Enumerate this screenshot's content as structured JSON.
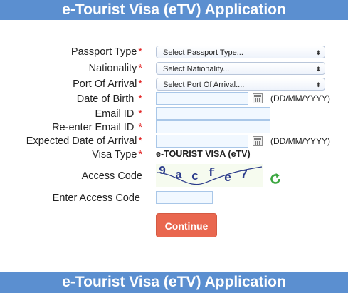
{
  "header": {
    "title": "e-Tourist Visa (eTV) Application"
  },
  "footer": {
    "title": "e-Tourist Visa (eTV) Application"
  },
  "form": {
    "passport_type": {
      "label": "Passport Type",
      "selected": "Select Passport Type..."
    },
    "nationality": {
      "label": "Nationality",
      "selected": "Select Nationality..."
    },
    "port_of_arrival": {
      "label": "Port Of Arrival",
      "selected": "Select Port Of Arrival...."
    },
    "date_of_birth": {
      "label": "Date of Birth",
      "value": "",
      "format_hint": "(DD/MM/YYYY)"
    },
    "email": {
      "label": "Email ID",
      "value": ""
    },
    "reenter_email": {
      "label": "Re-enter Email ID",
      "value": ""
    },
    "expected_arrival": {
      "label": "Expected Date of Arrival",
      "value": "",
      "format_hint": "(DD/MM/YYYY)"
    },
    "visa_type": {
      "label": "Visa Type",
      "value": "e-TOURIST VISA (eTV)"
    },
    "access_code": {
      "label": "Access Code",
      "captcha_text": "9acfe7",
      "refresh_icon": "refresh-icon"
    },
    "enter_access_code": {
      "label": "Enter Access Code",
      "value": ""
    },
    "continue_label": "Continue",
    "required_marker": "*"
  },
  "colors": {
    "banner": "#5b8fd0",
    "required": "#e21d1d",
    "button": "#e9674f",
    "input_bg": "#f1f8ff",
    "refresh": "#3aa63f"
  }
}
